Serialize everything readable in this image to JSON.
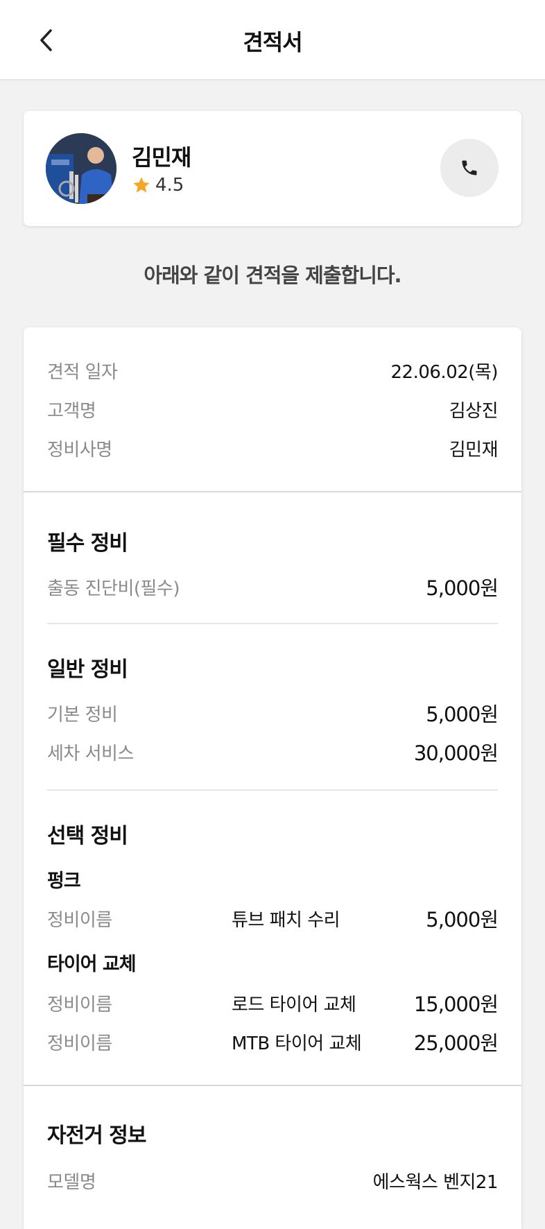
{
  "header": {
    "title": "견적서"
  },
  "profile": {
    "name": "김민재",
    "rating": "4.5"
  },
  "intro": "아래와 같이 견적을 제출합니다.",
  "info": [
    {
      "label": "견적 일자",
      "value": "22.06.02(목)"
    },
    {
      "label": "고객명",
      "value": "김상진"
    },
    {
      "label": "정비사명",
      "value": "김민재"
    }
  ],
  "required": {
    "title": "필수 정비",
    "items": [
      {
        "label": "출동 진단비(필수)",
        "price": "5,000원"
      }
    ]
  },
  "general": {
    "title": "일반 정비",
    "items": [
      {
        "label": "기본 정비",
        "price": "5,000원"
      },
      {
        "label": "세차 서비스",
        "price": "30,000원"
      }
    ]
  },
  "optional": {
    "title": "선택 정비",
    "groups": [
      {
        "name": "펑크",
        "items": [
          {
            "label": "정비이름",
            "name": "튜브 패치 수리",
            "price": "5,000원"
          }
        ]
      },
      {
        "name": "타이어 교체",
        "items": [
          {
            "label": "정비이름",
            "name": "로드 타이어 교체",
            "price": "15,000원"
          },
          {
            "label": "정비이름",
            "name": "MTB 타이어 교체",
            "price": "25,000원"
          }
        ]
      }
    ]
  },
  "bike": {
    "title": "자전거 정보",
    "rows": [
      {
        "label": "모델명",
        "value": "에스웍스 벤지21"
      }
    ]
  },
  "colors": {
    "star": "#f5a623",
    "background": "#f2f2f2",
    "label": "#8a8a8a"
  },
  "icons": {
    "back": "chevron-left-icon",
    "call": "phone-icon",
    "star": "star-icon"
  }
}
